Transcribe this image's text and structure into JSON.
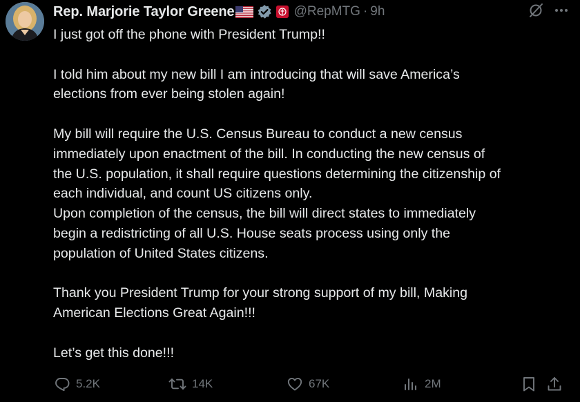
{
  "tweet": {
    "author": {
      "display_name": "Rep. Marjorie Taylor Greene",
      "handle": "@RepMTG",
      "separator": "·",
      "time": "9h"
    },
    "body": "I just got off the phone with President Trump!!\n\nI told him about my new bill I am introducing that will save America’s\nelections from ever being stolen again!\n\nMy bill will require the U.S. Census Bureau to conduct a new census\nimmediately upon enactment of the bill. In conducting the new census of\nthe U.S. population, it shall require questions determining the citizenship of\neach individual, and count US citizens only.\nUpon completion of the census, the bill will direct states to immediately\nbegin a redistricting of all U.S. House seats process using only the\npopulation of United States citizens.\n\nThank you President Trump for your strong support of my bill, Making\nAmerican Elections Great Again!!!\n\nLet’s get this done!!!",
    "metrics": {
      "replies": "5.2K",
      "reposts": "14K",
      "likes": "67K",
      "views": "2M"
    }
  },
  "colors": {
    "background": "#000000",
    "text": "#e7e9ea",
    "muted": "#71767b",
    "verified_badge": "#829aab",
    "affiliate_badge": "#c8102e"
  },
  "icons": {
    "flag": "us-flag-icon",
    "verified": "verified-badge-icon",
    "affiliation": "government-affiliation-icon",
    "grok": "grok-icon",
    "more": "more-icon",
    "reply": "reply-icon",
    "repost": "repost-icon",
    "like": "heart-icon",
    "views": "views-icon",
    "bookmark": "bookmark-icon",
    "share": "share-icon"
  }
}
